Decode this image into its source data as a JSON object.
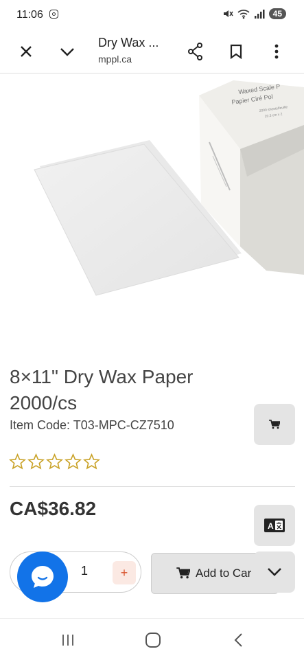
{
  "status_bar": {
    "time": "11:06",
    "battery": "45",
    "icons": [
      "instagram-icon",
      "mute-icon",
      "wifi-icon",
      "signal-icon"
    ]
  },
  "browser": {
    "title": "Dry Wax ...",
    "domain": "mppl.ca",
    "icons": [
      "close-icon",
      "chevron-down-icon",
      "share-icon",
      "bookmark-icon",
      "more-vertical-icon"
    ]
  },
  "product": {
    "image_alt": "Dry wax paper sheet with product box",
    "box_print": [
      "Waxed Scale P",
      "Papier Ciré Pol",
      "2000 sheets/feuille",
      "20.3 cm x 2"
    ],
    "title": "8×11\" Dry Wax Paper 2000/cs",
    "item_code": "Item Code: T03-MPC-CZ7510",
    "rating": 0,
    "rating_max": 5,
    "price": "CA$36.82",
    "quantity": "1",
    "plus_label": "+",
    "add_to_cart_label": "Add to Car"
  },
  "colors": {
    "accent_blue": "#1273e8",
    "star_gold": "#c9a227",
    "plus_orange": "#d9532c",
    "fab_gray": "#e4e4e4"
  },
  "nav_bar": {
    "icons": [
      "recent-apps-icon",
      "home-icon",
      "back-icon"
    ]
  }
}
